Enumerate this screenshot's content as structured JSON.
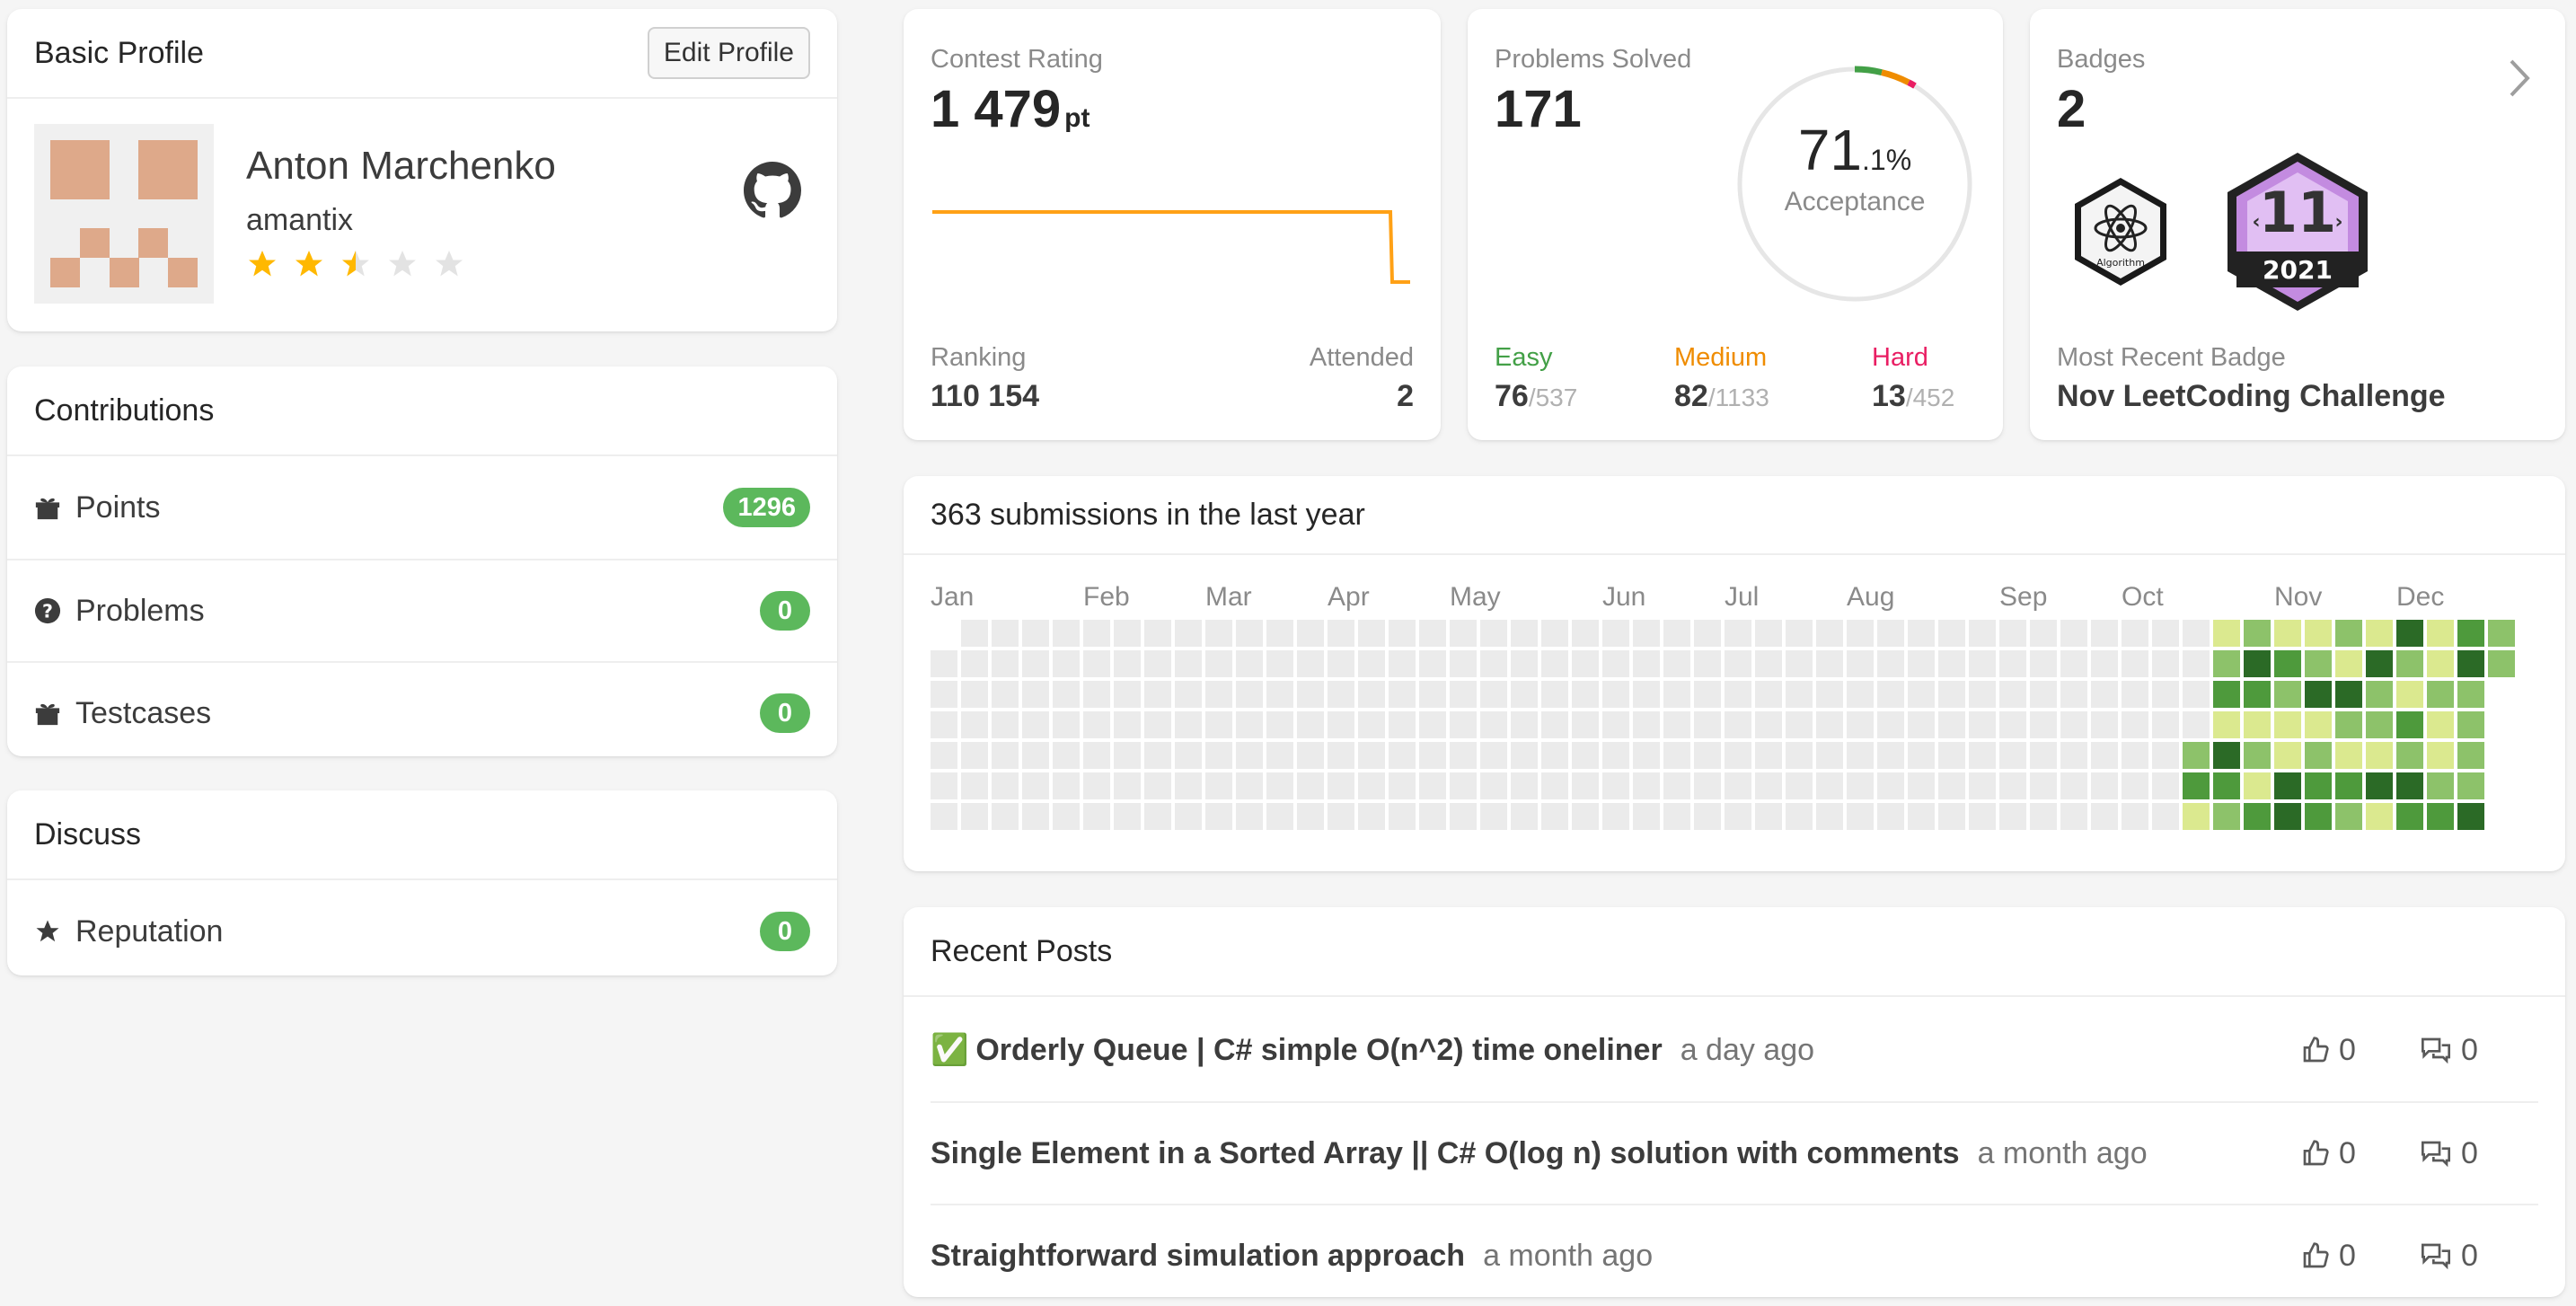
{
  "profile": {
    "header": "Basic Profile",
    "edit_label": "Edit Profile",
    "name": "Anton Marchenko",
    "username": "amantix",
    "rating_stars": 2.5,
    "max_stars": 5,
    "github_icon": "github-icon"
  },
  "contributions": {
    "header": "Contributions",
    "items": [
      {
        "label": "Points",
        "value": "1296",
        "icon": "gift-icon"
      },
      {
        "label": "Problems",
        "value": "0",
        "icon": "question-icon"
      },
      {
        "label": "Testcases",
        "value": "0",
        "icon": "gift-icon"
      }
    ]
  },
  "discuss": {
    "header": "Discuss",
    "items": [
      {
        "label": "Reputation",
        "value": "0",
        "icon": "star-icon"
      }
    ]
  },
  "contest": {
    "title": "Contest Rating",
    "rating": "1 479",
    "rating_unit": "pt",
    "ranking_label": "Ranking",
    "ranking": "110 154",
    "attended_label": "Attended",
    "attended": "2",
    "line_color": "#ffa116"
  },
  "solved": {
    "title": "Problems Solved",
    "total": "171",
    "acceptance_int": "71",
    "acceptance_dec": ".1%",
    "acceptance_label": "Acceptance",
    "easy_label": "Easy",
    "easy": "76",
    "easy_total": "/537",
    "medium_label": "Medium",
    "medium": "82",
    "medium_total": "/1133",
    "hard_label": "Hard",
    "hard": "13",
    "hard_total": "/452",
    "colors": {
      "easy": "#43a047",
      "medium": "#ef8c00",
      "hard": "#e91e63"
    }
  },
  "badges": {
    "title": "Badges",
    "count": "2",
    "recent_label": "Most Recent Badge",
    "recent_name": "Nov LeetCoding Challenge",
    "badge1_caption": "Algorithm",
    "badge2_number": "11",
    "badge2_year": "2021"
  },
  "heatmap": {
    "title": "363 submissions in the last year",
    "months": [
      "Jan",
      "Feb",
      "Mar",
      "Apr",
      "May",
      "Jun",
      "Jul",
      "Aug",
      "Sep",
      "Oct",
      "Nov",
      "Dec"
    ],
    "levels_colors": [
      "#ebebeb",
      "#dbe98f",
      "#8dc26a",
      "#4e9a3c",
      "#2b6a26"
    ]
  },
  "posts": {
    "header": "Recent Posts",
    "items": [
      {
        "check": "✅",
        "title": "Orderly Queue | C# simple O(n^2) time oneliner",
        "time": "a day ago",
        "likes": "0",
        "comments": "0"
      },
      {
        "check": "",
        "title": "Single Element in a Sorted Array || C# O(log n) solution with comments",
        "time": "a month ago",
        "likes": "0",
        "comments": "0"
      },
      {
        "check": "",
        "title": "Straightforward simulation approach",
        "time": "a month ago",
        "likes": "0",
        "comments": "0"
      }
    ]
  }
}
